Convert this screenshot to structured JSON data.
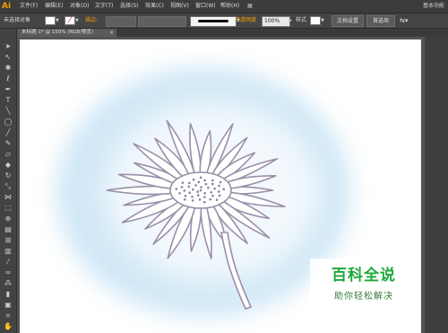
{
  "app": {
    "logo": "Ai"
  },
  "menu": {
    "items": [
      "文件(F)",
      "编辑(E)",
      "对象(O)",
      "文字(T)",
      "选择(S)",
      "效果(C)",
      "视图(V)",
      "窗口(W)",
      "帮助(H)"
    ],
    "workspace": "基本功能"
  },
  "control": {
    "selection_status": "未选择对象",
    "stroke_label": "描边:",
    "opacity_label": "不透明度",
    "opacity_value": "100%",
    "style_label": "样式",
    "doc_setup_button": "文档设置",
    "preferences_button": "首选项"
  },
  "document": {
    "tab_title": "未标题-1* @ 150% (RGB/预览)",
    "close": "×"
  },
  "watermark": {
    "title": "百科全说",
    "subtitle": "助你轻松解决"
  },
  "colors": {
    "accent": "#f0a000",
    "watermark_green": "#1fa93b",
    "glow_blue": "#cfe7f6",
    "flower_stroke": "#9a8fa8"
  }
}
